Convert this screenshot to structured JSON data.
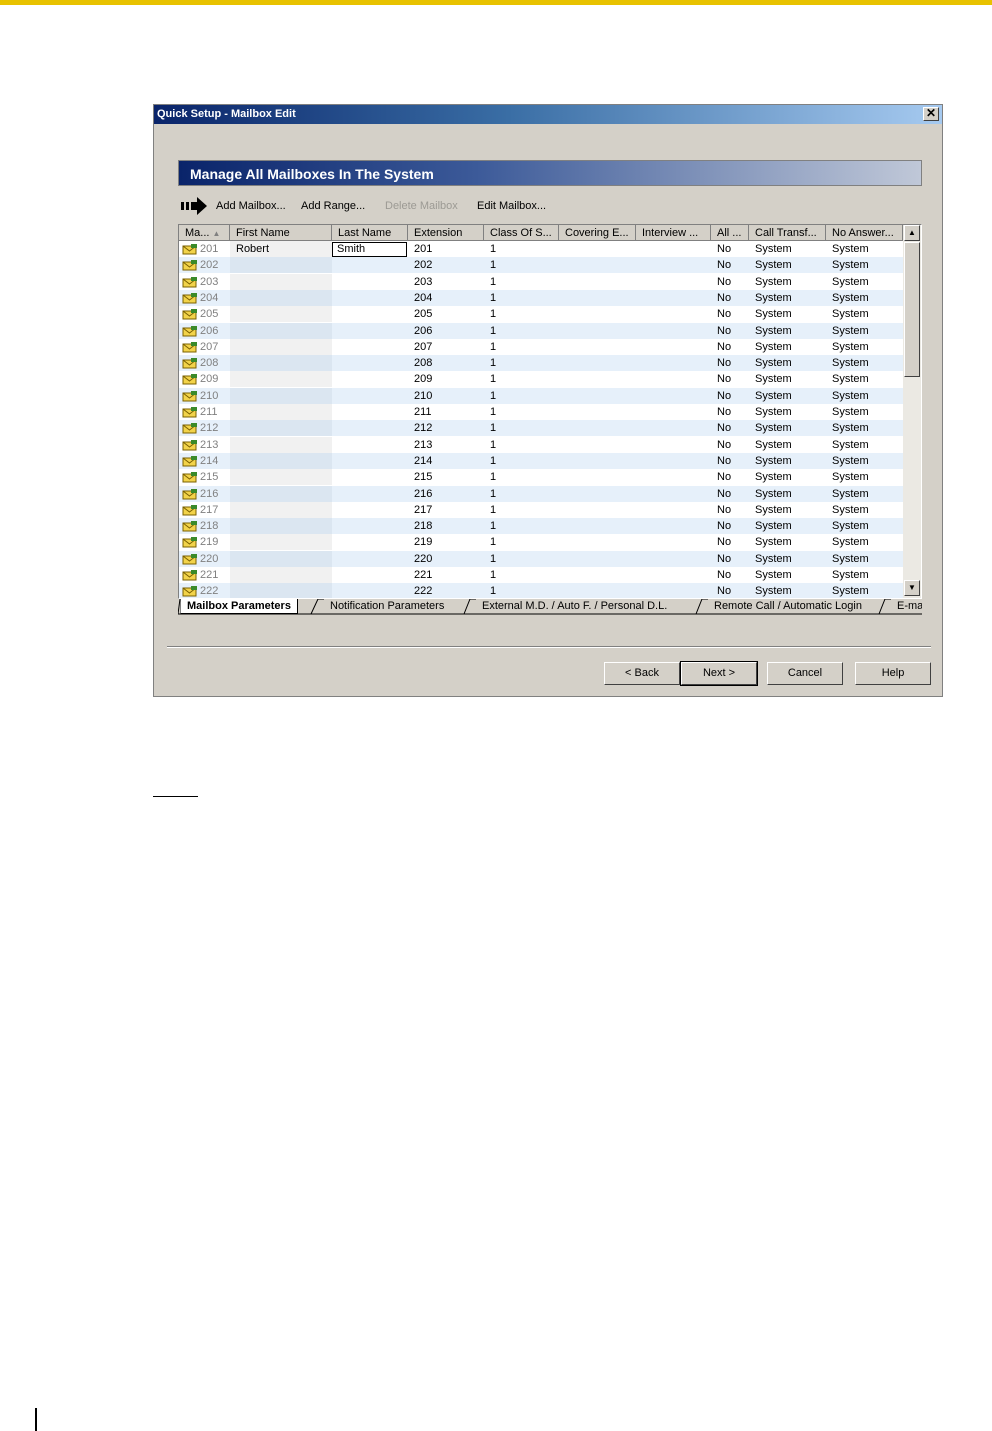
{
  "window": {
    "title": "Quick Setup - Mailbox Edit",
    "close_label": "✕"
  },
  "header": {
    "title": "Manage All Mailboxes In The System"
  },
  "toolbar": {
    "add_mailbox": "Add Mailbox...",
    "add_range": "Add Range...",
    "delete_mailbox": "Delete Mailbox",
    "edit_mailbox": "Edit Mailbox..."
  },
  "grid": {
    "columns": [
      "Ma...",
      "First Name",
      "Last Name",
      "Extension",
      "Class Of S...",
      "Covering E...",
      "Interview ...",
      "All ...",
      "Call Transf...",
      "No Answer..."
    ],
    "sort_indicator": "▲",
    "rows": [
      {
        "mailbox": "201",
        "first": "Robert",
        "last": "Smith",
        "ext": "201",
        "cos": "1",
        "cov": "",
        "int": "",
        "all": "No",
        "ct": "System",
        "na": "System"
      },
      {
        "mailbox": "202",
        "first": "",
        "last": "",
        "ext": "202",
        "cos": "1",
        "cov": "",
        "int": "",
        "all": "No",
        "ct": "System",
        "na": "System"
      },
      {
        "mailbox": "203",
        "first": "",
        "last": "",
        "ext": "203",
        "cos": "1",
        "cov": "",
        "int": "",
        "all": "No",
        "ct": "System",
        "na": "System"
      },
      {
        "mailbox": "204",
        "first": "",
        "last": "",
        "ext": "204",
        "cos": "1",
        "cov": "",
        "int": "",
        "all": "No",
        "ct": "System",
        "na": "System"
      },
      {
        "mailbox": "205",
        "first": "",
        "last": "",
        "ext": "205",
        "cos": "1",
        "cov": "",
        "int": "",
        "all": "No",
        "ct": "System",
        "na": "System"
      },
      {
        "mailbox": "206",
        "first": "",
        "last": "",
        "ext": "206",
        "cos": "1",
        "cov": "",
        "int": "",
        "all": "No",
        "ct": "System",
        "na": "System"
      },
      {
        "mailbox": "207",
        "first": "",
        "last": "",
        "ext": "207",
        "cos": "1",
        "cov": "",
        "int": "",
        "all": "No",
        "ct": "System",
        "na": "System"
      },
      {
        "mailbox": "208",
        "first": "",
        "last": "",
        "ext": "208",
        "cos": "1",
        "cov": "",
        "int": "",
        "all": "No",
        "ct": "System",
        "na": "System"
      },
      {
        "mailbox": "209",
        "first": "",
        "last": "",
        "ext": "209",
        "cos": "1",
        "cov": "",
        "int": "",
        "all": "No",
        "ct": "System",
        "na": "System"
      },
      {
        "mailbox": "210",
        "first": "",
        "last": "",
        "ext": "210",
        "cos": "1",
        "cov": "",
        "int": "",
        "all": "No",
        "ct": "System",
        "na": "System"
      },
      {
        "mailbox": "211",
        "first": "",
        "last": "",
        "ext": "211",
        "cos": "1",
        "cov": "",
        "int": "",
        "all": "No",
        "ct": "System",
        "na": "System"
      },
      {
        "mailbox": "212",
        "first": "",
        "last": "",
        "ext": "212",
        "cos": "1",
        "cov": "",
        "int": "",
        "all": "No",
        "ct": "System",
        "na": "System"
      },
      {
        "mailbox": "213",
        "first": "",
        "last": "",
        "ext": "213",
        "cos": "1",
        "cov": "",
        "int": "",
        "all": "No",
        "ct": "System",
        "na": "System"
      },
      {
        "mailbox": "214",
        "first": "",
        "last": "",
        "ext": "214",
        "cos": "1",
        "cov": "",
        "int": "",
        "all": "No",
        "ct": "System",
        "na": "System"
      },
      {
        "mailbox": "215",
        "first": "",
        "last": "",
        "ext": "215",
        "cos": "1",
        "cov": "",
        "int": "",
        "all": "No",
        "ct": "System",
        "na": "System"
      },
      {
        "mailbox": "216",
        "first": "",
        "last": "",
        "ext": "216",
        "cos": "1",
        "cov": "",
        "int": "",
        "all": "No",
        "ct": "System",
        "na": "System"
      },
      {
        "mailbox": "217",
        "first": "",
        "last": "",
        "ext": "217",
        "cos": "1",
        "cov": "",
        "int": "",
        "all": "No",
        "ct": "System",
        "na": "System"
      },
      {
        "mailbox": "218",
        "first": "",
        "last": "",
        "ext": "218",
        "cos": "1",
        "cov": "",
        "int": "",
        "all": "No",
        "ct": "System",
        "na": "System"
      },
      {
        "mailbox": "219",
        "first": "",
        "last": "",
        "ext": "219",
        "cos": "1",
        "cov": "",
        "int": "",
        "all": "No",
        "ct": "System",
        "na": "System"
      },
      {
        "mailbox": "220",
        "first": "",
        "last": "",
        "ext": "220",
        "cos": "1",
        "cov": "",
        "int": "",
        "all": "No",
        "ct": "System",
        "na": "System"
      },
      {
        "mailbox": "221",
        "first": "",
        "last": "",
        "ext": "221",
        "cos": "1",
        "cov": "",
        "int": "",
        "all": "No",
        "ct": "System",
        "na": "System"
      },
      {
        "mailbox": "222",
        "first": "",
        "last": "",
        "ext": "222",
        "cos": "1",
        "cov": "",
        "int": "",
        "all": "No",
        "ct": "System",
        "na": "System"
      }
    ]
  },
  "scrollbar": {
    "up_glyph": "▲",
    "down_glyph": "▼"
  },
  "tabs": [
    "Mailbox Parameters",
    "Notification Parameters",
    "External M.D. / Auto F. / Personal D.L.",
    "Remote Call / Automatic Login",
    "E-ma"
  ],
  "buttons": {
    "back": "< Back",
    "next": "Next >",
    "cancel": "Cancel",
    "help": "Help"
  }
}
